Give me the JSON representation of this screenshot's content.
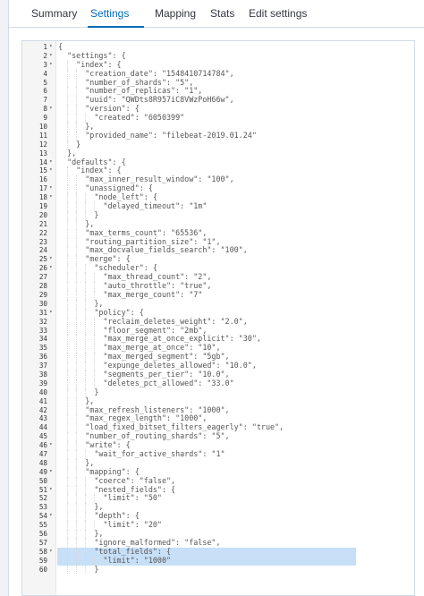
{
  "tabs": [
    {
      "label": "Summary",
      "active": false
    },
    {
      "label": "Settings",
      "active": true
    },
    {
      "label": "Mapping",
      "active": false
    },
    {
      "label": "Stats",
      "active": false
    },
    {
      "label": "Edit settings",
      "active": false
    }
  ],
  "editor": {
    "highlight_color": "#c7dff7",
    "selected_lines": [
      58,
      59
    ],
    "lines": [
      {
        "n": "1",
        "fold": true,
        "text": "{"
      },
      {
        "n": "2",
        "fold": true,
        "text": "  \"settings\": {"
      },
      {
        "n": "3",
        "fold": true,
        "text": "    \"index\": {"
      },
      {
        "n": "4",
        "fold": false,
        "text": "      \"creation_date\": \"1548410714784\","
      },
      {
        "n": "5",
        "fold": false,
        "text": "      \"number_of_shards\": \"5\","
      },
      {
        "n": "6",
        "fold": false,
        "text": "      \"number_of_replicas\": \"1\","
      },
      {
        "n": "7",
        "fold": false,
        "text": "      \"uuid\": \"QWDts8R957iC8VWzPoH66w\","
      },
      {
        "n": "8",
        "fold": true,
        "text": "      \"version\": {"
      },
      {
        "n": "9",
        "fold": false,
        "text": "        \"created\": \"6050399\""
      },
      {
        "n": "10",
        "fold": false,
        "text": "      },"
      },
      {
        "n": "11",
        "fold": false,
        "text": "      \"provided_name\": \"filebeat-2019.01.24\""
      },
      {
        "n": "12",
        "fold": false,
        "text": "    }"
      },
      {
        "n": "13",
        "fold": false,
        "text": "  },"
      },
      {
        "n": "14",
        "fold": true,
        "text": "  \"defaults\": {"
      },
      {
        "n": "15",
        "fold": true,
        "text": "    \"index\": {"
      },
      {
        "n": "16",
        "fold": false,
        "text": "      \"max_inner_result_window\": \"100\","
      },
      {
        "n": "17",
        "fold": true,
        "text": "      \"unassigned\": {"
      },
      {
        "n": "18",
        "fold": true,
        "text": "        \"node_left\": {"
      },
      {
        "n": "19",
        "fold": false,
        "text": "          \"delayed_timeout\": \"1m\""
      },
      {
        "n": "20",
        "fold": false,
        "text": "        }"
      },
      {
        "n": "21",
        "fold": false,
        "text": "      },"
      },
      {
        "n": "22",
        "fold": false,
        "text": "      \"max_terms_count\": \"65536\","
      },
      {
        "n": "23",
        "fold": false,
        "text": "      \"routing_partition_size\": \"1\","
      },
      {
        "n": "24",
        "fold": false,
        "text": "      \"max_docvalue_fields_search\": \"100\","
      },
      {
        "n": "25",
        "fold": true,
        "text": "      \"merge\": {"
      },
      {
        "n": "26",
        "fold": true,
        "text": "        \"scheduler\": {"
      },
      {
        "n": "27",
        "fold": false,
        "text": "          \"max_thread_count\": \"2\","
      },
      {
        "n": "28",
        "fold": false,
        "text": "          \"auto_throttle\": \"true\","
      },
      {
        "n": "29",
        "fold": false,
        "text": "          \"max_merge_count\": \"7\""
      },
      {
        "n": "30",
        "fold": false,
        "text": "        },"
      },
      {
        "n": "31",
        "fold": true,
        "text": "        \"policy\": {"
      },
      {
        "n": "32",
        "fold": false,
        "text": "          \"reclaim_deletes_weight\": \"2.0\","
      },
      {
        "n": "33",
        "fold": false,
        "text": "          \"floor_segment\": \"2mb\","
      },
      {
        "n": "34",
        "fold": false,
        "text": "          \"max_merge_at_once_explicit\": \"30\","
      },
      {
        "n": "35",
        "fold": false,
        "text": "          \"max_merge_at_once\": \"10\","
      },
      {
        "n": "36",
        "fold": false,
        "text": "          \"max_merged_segment\": \"5gb\","
      },
      {
        "n": "37",
        "fold": false,
        "text": "          \"expunge_deletes_allowed\": \"10.0\","
      },
      {
        "n": "38",
        "fold": false,
        "text": "          \"segments_per_tier\": \"10.0\","
      },
      {
        "n": "39",
        "fold": false,
        "text": "          \"deletes_pct_allowed\": \"33.0\""
      },
      {
        "n": "40",
        "fold": false,
        "text": "        }"
      },
      {
        "n": "41",
        "fold": false,
        "text": "      },"
      },
      {
        "n": "42",
        "fold": false,
        "text": "      \"max_refresh_listeners\": \"1000\","
      },
      {
        "n": "43",
        "fold": false,
        "text": "      \"max_regex_length\": \"1000\","
      },
      {
        "n": "44",
        "fold": false,
        "text": "      \"load_fixed_bitset_filters_eagerly\": \"true\","
      },
      {
        "n": "45",
        "fold": false,
        "text": "      \"number_of_routing_shards\": \"5\","
      },
      {
        "n": "46",
        "fold": true,
        "text": "      \"write\": {"
      },
      {
        "n": "47",
        "fold": false,
        "text": "        \"wait_for_active_shards\": \"1\""
      },
      {
        "n": "48",
        "fold": false,
        "text": "      },"
      },
      {
        "n": "49",
        "fold": true,
        "text": "      \"mapping\": {"
      },
      {
        "n": "50",
        "fold": false,
        "text": "        \"coerce\": \"false\","
      },
      {
        "n": "51",
        "fold": true,
        "text": "        \"nested_fields\": {"
      },
      {
        "n": "52",
        "fold": false,
        "text": "          \"limit\": \"50\""
      },
      {
        "n": "53",
        "fold": false,
        "text": "        },"
      },
      {
        "n": "54",
        "fold": true,
        "text": "        \"depth\": {"
      },
      {
        "n": "55",
        "fold": false,
        "text": "          \"limit\": \"20\""
      },
      {
        "n": "56",
        "fold": false,
        "text": "        },"
      },
      {
        "n": "57",
        "fold": false,
        "text": "        \"ignore_malformed\": \"false\","
      },
      {
        "n": "58",
        "fold": true,
        "text": "        \"total_fields\": {"
      },
      {
        "n": "59",
        "fold": false,
        "text": "          \"limit\": \"1000\""
      },
      {
        "n": "60",
        "fold": false,
        "text": "        }"
      }
    ]
  }
}
